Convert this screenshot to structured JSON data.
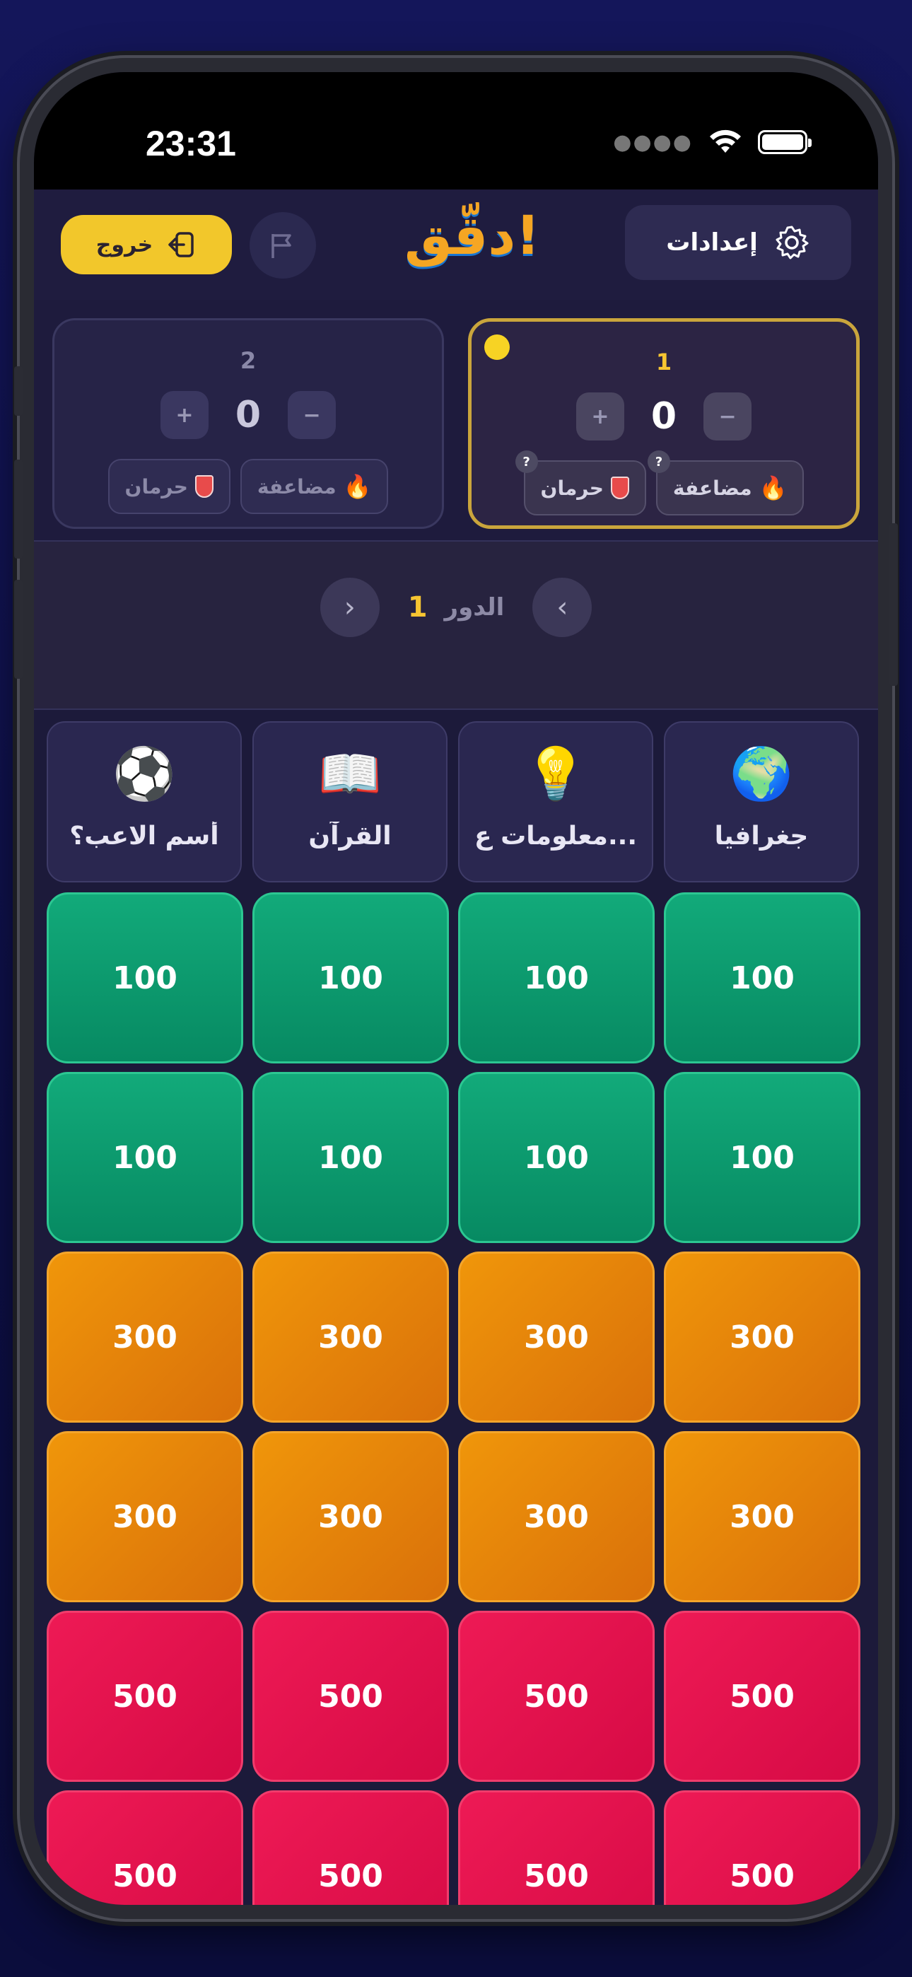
{
  "status_bar": {
    "time": "23:31",
    "signal_icon": "cellular-dots-icon",
    "wifi_icon": "wifi-icon",
    "battery_icon": "battery-icon"
  },
  "header": {
    "exit_label": "خروج",
    "logo_text": "دقّق!",
    "settings_label": "إعدادات"
  },
  "teams": [
    {
      "number": "1",
      "score": "0",
      "plus": "+",
      "minus": "−",
      "double_label": "مضاعفة",
      "deny_label": "حرمان",
      "hint": "?",
      "active": true
    },
    {
      "number": "2",
      "score": "0",
      "plus": "+",
      "minus": "−",
      "double_label": "مضاعفة",
      "deny_label": "حرمان",
      "hint": "?",
      "active": false
    }
  ],
  "turn": {
    "label": "الدور",
    "number": "1"
  },
  "categories": [
    {
      "label": "جغرافيا",
      "icon": "globe-icon",
      "glyph": "🌍"
    },
    {
      "label": "معلومات ع...",
      "icon": "book-idea-icon",
      "glyph": "💡"
    },
    {
      "label": "القرآن",
      "icon": "quran-icon",
      "glyph": "📖"
    },
    {
      "label": "أسم الاعب؟",
      "icon": "football-player-icon",
      "glyph": "⚽"
    }
  ],
  "rows": [
    {
      "value": "100",
      "color": "#0a9a6e"
    },
    {
      "value": "100",
      "color": "#0a9a6e"
    },
    {
      "value": "300",
      "color": "#e5830a"
    },
    {
      "value": "300",
      "color": "#e5830a"
    },
    {
      "value": "500",
      "color": "#e5124d"
    },
    {
      "value": "500",
      "color": "#e5124d"
    }
  ]
}
